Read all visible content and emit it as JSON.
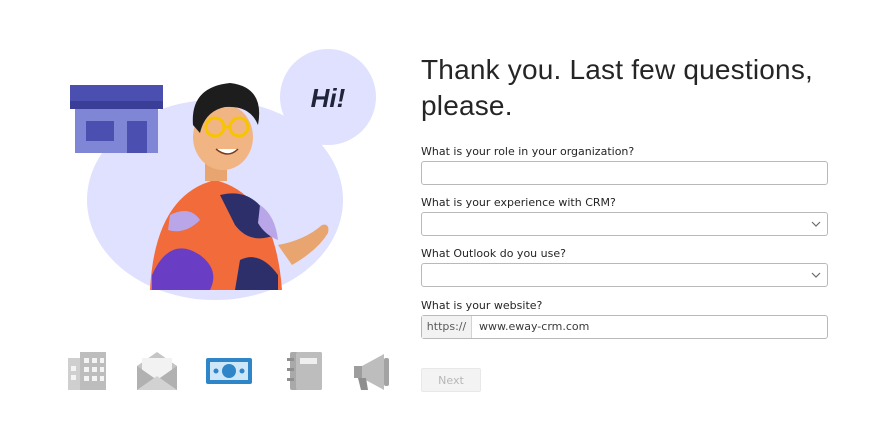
{
  "illustration": {
    "greeting": "Hi!"
  },
  "form": {
    "title": "Thank you. Last few questions, please.",
    "role": {
      "label": "What is your role in your organization?",
      "value": ""
    },
    "crm": {
      "label": "What is your experience with CRM?",
      "value": ""
    },
    "outlook": {
      "label": "What Outlook do you use?",
      "value": ""
    },
    "website": {
      "label": "What is your website?",
      "prefix": "https://",
      "value": "www.eway-crm.com"
    },
    "next_label": "Next"
  },
  "steps": [
    {
      "icon": "building-icon",
      "active": false
    },
    {
      "icon": "envelope-icon",
      "active": false
    },
    {
      "icon": "money-icon",
      "active": true
    },
    {
      "icon": "notebook-icon",
      "active": false
    },
    {
      "icon": "megaphone-icon",
      "active": false
    }
  ],
  "colors": {
    "accent": "#2e86c9",
    "illustration_blob": "#dcdcff",
    "shop_roof": "#4a4fb0",
    "shirt_orange": "#f26b3a",
    "shirt_purple": "#6a3ec4"
  }
}
